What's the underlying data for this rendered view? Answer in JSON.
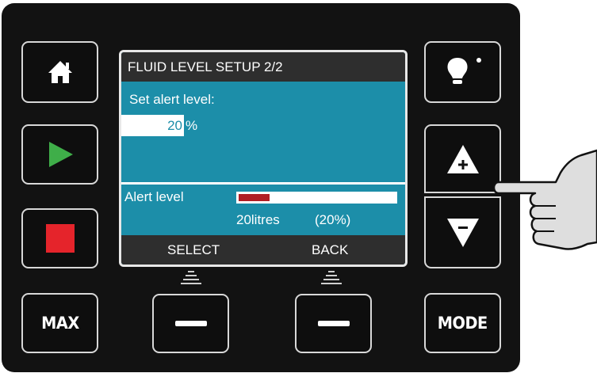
{
  "screen": {
    "title": "FLUID LEVEL SETUP 2/2",
    "prompt": "Set alert level:",
    "value": "20",
    "unit": "%",
    "alert_label": "Alert level",
    "alert_fraction": 0.2,
    "litres": "20litres",
    "percent": "(20%)",
    "softkey_left": "SELECT",
    "softkey_right": "BACK"
  },
  "buttons": {
    "max": "MAX",
    "mode": "MODE"
  },
  "icons": {
    "home": "home-icon",
    "play": "play-icon",
    "stop": "stop-icon",
    "light": "light-bulb-icon",
    "plus": "plus-triangle-icon",
    "minus": "minus-triangle-icon",
    "pointer": "pointing-hand-icon"
  },
  "colors": {
    "screen_bg": "#1c8ea9",
    "bar_fill": "#b01e24",
    "play": "#3fae49",
    "stop": "#e5242b"
  }
}
